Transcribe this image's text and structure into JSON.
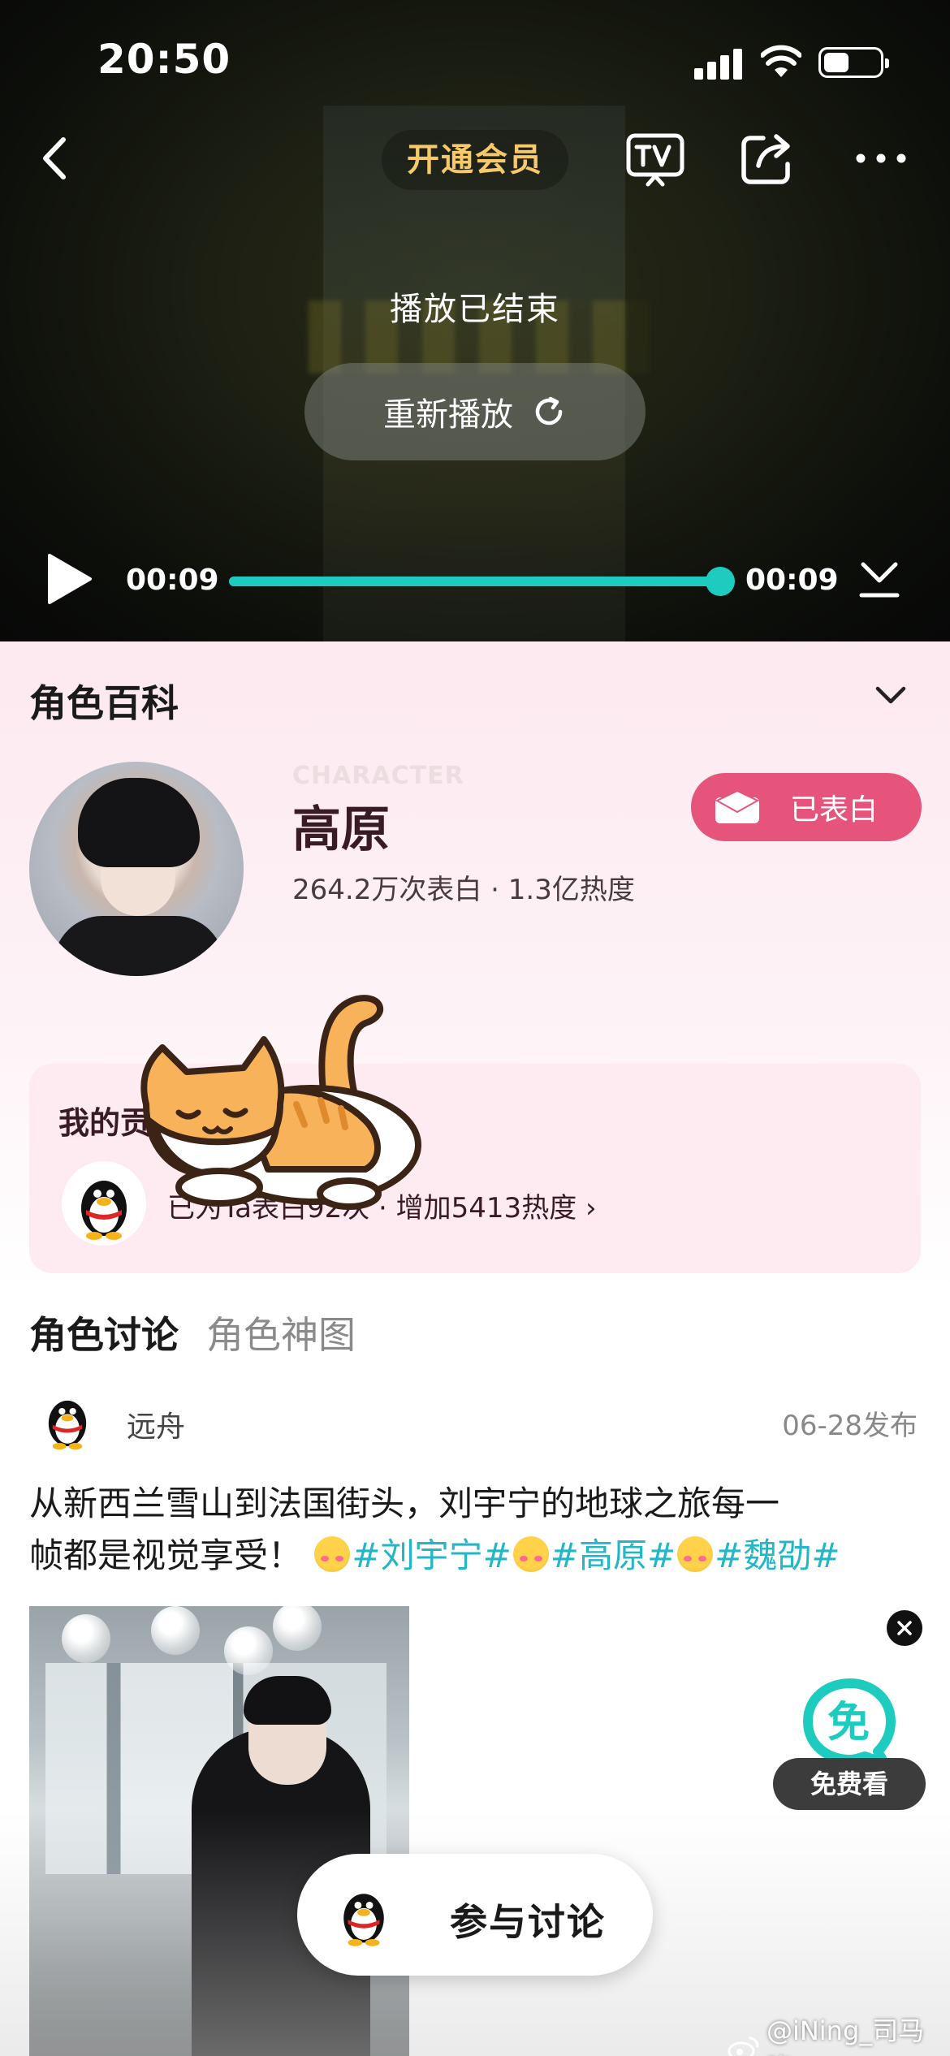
{
  "status_bar": {
    "time": "20:50"
  },
  "player": {
    "vip_label": "开通会员",
    "ended_text": "播放已结束",
    "replay_label": "重新播放",
    "current_time": "00:09",
    "total_time": "00:09",
    "progress": 1.0,
    "accent_color": "#1ecbbf"
  },
  "wiki": {
    "title": "角色百科",
    "character_en": "CHARACTER",
    "character_name": "高原",
    "stats": "264.2万次表白 · 1.3亿热度",
    "confess_label": "已表白",
    "confess_color": "#e6547c",
    "my_card": {
      "title": "我的贡",
      "stats": "已为Ta表白92次 · 增加5413热度 ›"
    }
  },
  "discussion": {
    "tabs": [
      {
        "label": "角色讨论",
        "active": true
      },
      {
        "label": "角色神图",
        "active": false
      }
    ],
    "post": {
      "author": "远舟",
      "date": "06-28发布",
      "text_line1": "从新西兰雪山到法国街头，刘宇宁的地球之旅每一",
      "text_line2_prefix": "帧都是视觉享受！",
      "tags": [
        "#刘宇宁#",
        "#高原#",
        "#魏劭#"
      ],
      "tag_color": "#22b6c6"
    }
  },
  "free_watch": {
    "logo_char": "免",
    "label": "免费看"
  },
  "join_label": "参与讨论",
  "watermark": "@iNing_司马晓"
}
